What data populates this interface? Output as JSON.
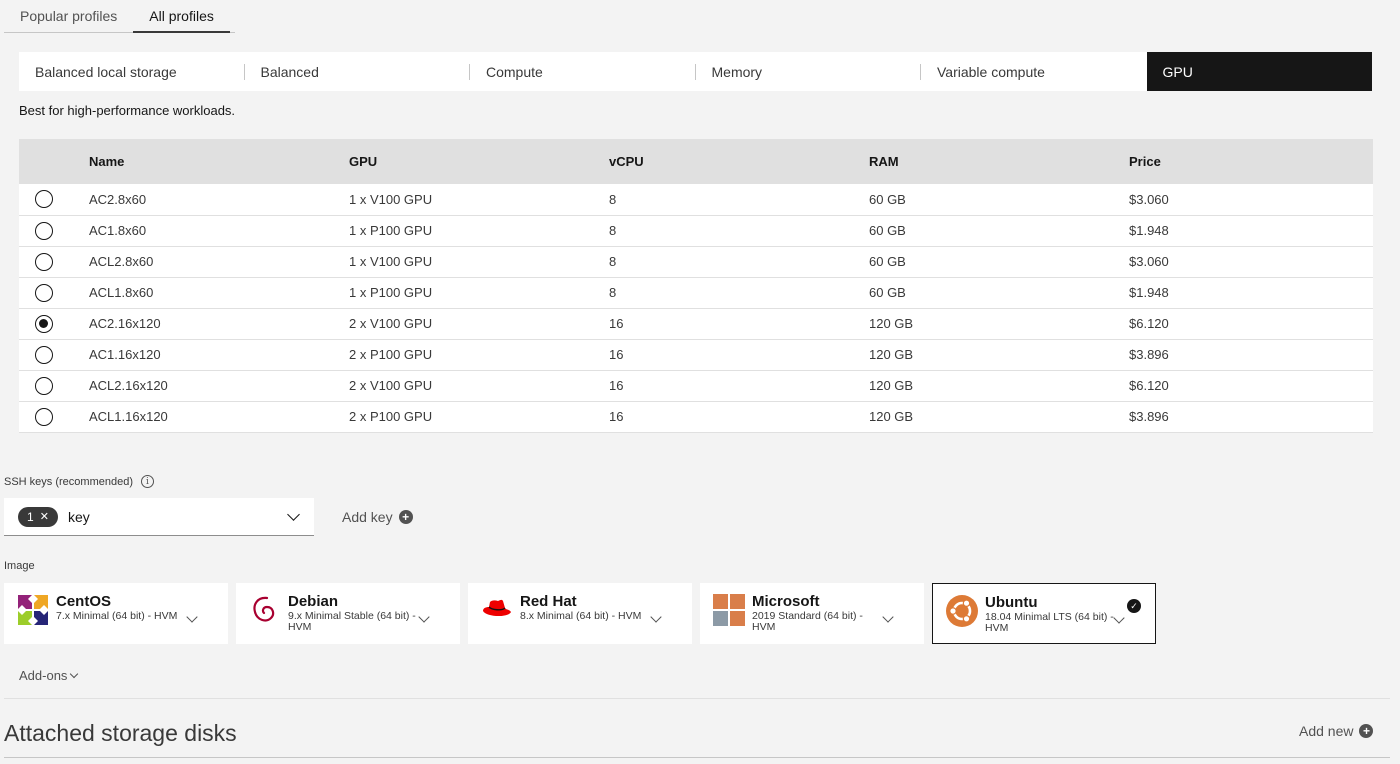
{
  "top_tabs": [
    "Popular profiles",
    "All profiles"
  ],
  "family_tabs": [
    "Balanced local storage",
    "Balanced",
    "Compute",
    "Memory",
    "Variable compute",
    "GPU"
  ],
  "family_description": "Best for high-performance workloads.",
  "table": {
    "headers": [
      "Name",
      "GPU",
      "vCPU",
      "RAM",
      "Price"
    ],
    "rows": [
      {
        "name": "AC2.8x60",
        "gpu": "1 x V100 GPU",
        "vcpu": "8",
        "ram": "60 GB",
        "price": "$3.060"
      },
      {
        "name": "AC1.8x60",
        "gpu": "1 x P100 GPU",
        "vcpu": "8",
        "ram": "60 GB",
        "price": "$1.948"
      },
      {
        "name": "ACL2.8x60",
        "gpu": "1 x V100 GPU",
        "vcpu": "8",
        "ram": "60 GB",
        "price": "$3.060"
      },
      {
        "name": "ACL1.8x60",
        "gpu": "1 x P100 GPU",
        "vcpu": "8",
        "ram": "60 GB",
        "price": "$1.948"
      },
      {
        "name": "AC2.16x120",
        "gpu": "2 x V100 GPU",
        "vcpu": "16",
        "ram": "120 GB",
        "price": "$6.120"
      },
      {
        "name": "AC1.16x120",
        "gpu": "2 x P100 GPU",
        "vcpu": "16",
        "ram": "120 GB",
        "price": "$3.896"
      },
      {
        "name": "ACL2.16x120",
        "gpu": "2 x V100 GPU",
        "vcpu": "16",
        "ram": "120 GB",
        "price": "$6.120"
      },
      {
        "name": "ACL1.16x120",
        "gpu": "2 x P100 GPU",
        "vcpu": "16",
        "ram": "120 GB",
        "price": "$3.896"
      }
    ],
    "selected_index": 4
  },
  "ssh": {
    "label": "SSH keys (recommended)",
    "info_icon": "info-icon",
    "tag_count": "1",
    "tag_remove": "✕",
    "value": "key",
    "add_key": "Add key"
  },
  "image": {
    "label": "Image",
    "tiles": [
      {
        "name": "CentOS",
        "version": "7.x Minimal (64 bit) - HVM",
        "icon": "centos-logo-icon",
        "selected": false
      },
      {
        "name": "Debian",
        "version": "9.x Minimal Stable (64 bit) - HVM",
        "icon": "debian-logo-icon",
        "selected": false
      },
      {
        "name": "Red Hat",
        "version": "8.x Minimal (64 bit) - HVM",
        "icon": "redhat-logo-icon",
        "selected": false
      },
      {
        "name": "Microsoft",
        "version": "2019 Standard (64 bit) - HVM",
        "icon": "microsoft-logo-icon",
        "selected": false
      },
      {
        "name": "Ubuntu",
        "version": "18.04 Minimal LTS (64 bit) - HVM",
        "icon": "ubuntu-logo-icon",
        "selected": true
      }
    ]
  },
  "addons": "Add-ons",
  "storage": {
    "title": "Attached storage disks",
    "add_new": "Add new"
  },
  "colors": {
    "active_tab_bg": "#161616",
    "page_bg": "#f3f3f3",
    "table_header_bg": "#e0e0e0"
  }
}
